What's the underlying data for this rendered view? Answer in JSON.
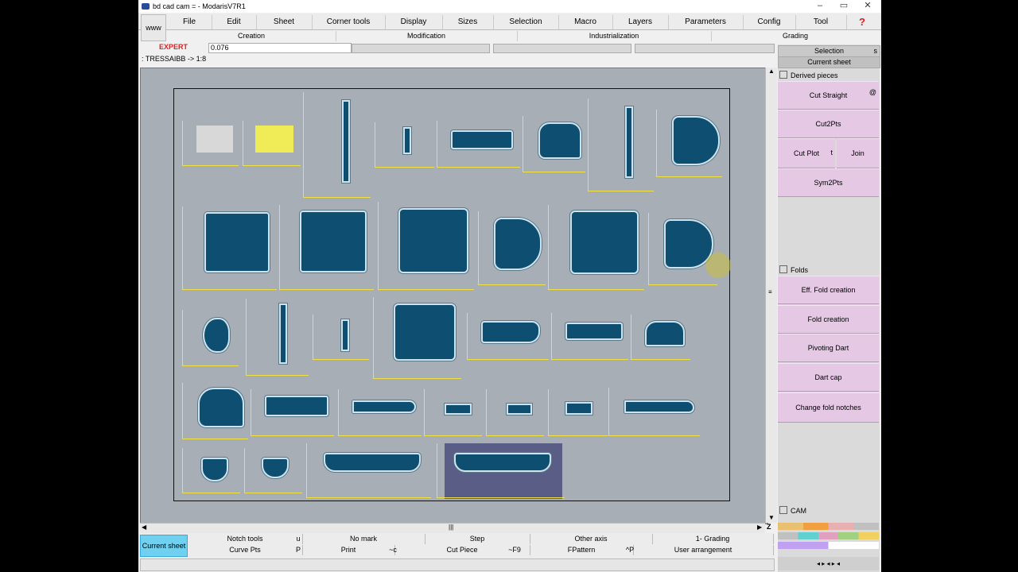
{
  "titlebar": {
    "title": "bd cad cam = - ModarisV7R1",
    "min": "–",
    "max": "▭",
    "close": "✕"
  },
  "menubar": {
    "www": "www",
    "items": [
      "File",
      "Edit",
      "Sheet",
      "Corner tools",
      "Display",
      "Sizes",
      "Selection",
      "Macro",
      "Layers",
      "Parameters",
      "Config",
      "Tool"
    ],
    "help": "?"
  },
  "submenu": {
    "items": [
      "Creation",
      "Modification",
      "Industrialization",
      "Grading"
    ]
  },
  "input": {
    "mode": "EXPERT",
    "value": "0.076"
  },
  "status": {
    "text": ": TRESSAIBB -> 1:8"
  },
  "sidebar": {
    "selection": "Selection",
    "selection_key": "s",
    "current_sheet": "Current sheet",
    "derived_label": "Derived pieces",
    "buttons_top": [
      "Cut Straight",
      "Cut2Pts",
      "Cut Plot",
      "Join",
      "Sym2Pts"
    ],
    "folds_label": "Folds",
    "buttons_folds": [
      "Eff. Fold creation",
      "Fold creation",
      "Pivoting Dart",
      "Dart cap",
      "Change fold notches"
    ],
    "cam_label": "CAM",
    "keys": {
      "cut_straight": "@",
      "cut_plot": "t"
    }
  },
  "bottom": {
    "current_sheet": "Current sheet",
    "row1": [
      "Notch tools",
      "No mark",
      "Step",
      "Other axis",
      "1- Grading"
    ],
    "row1_keys": [
      "u",
      "",
      "",
      "",
      ""
    ],
    "row2": [
      "Curve Pts",
      "Print",
      "Cut Piece",
      "FPattern",
      "User arrangement"
    ],
    "row2_keys": [
      "P",
      "~c",
      "~F9",
      "^P",
      ""
    ]
  },
  "scroll": {
    "z": "Z"
  },
  "colors": {
    "piece": "#0e4e70",
    "canvas": "#a7aeb6",
    "accent": "#6fd0f0",
    "sidebar_btn": "#e4c8e4",
    "expert": "#e02020",
    "frame": "#f0e040"
  }
}
